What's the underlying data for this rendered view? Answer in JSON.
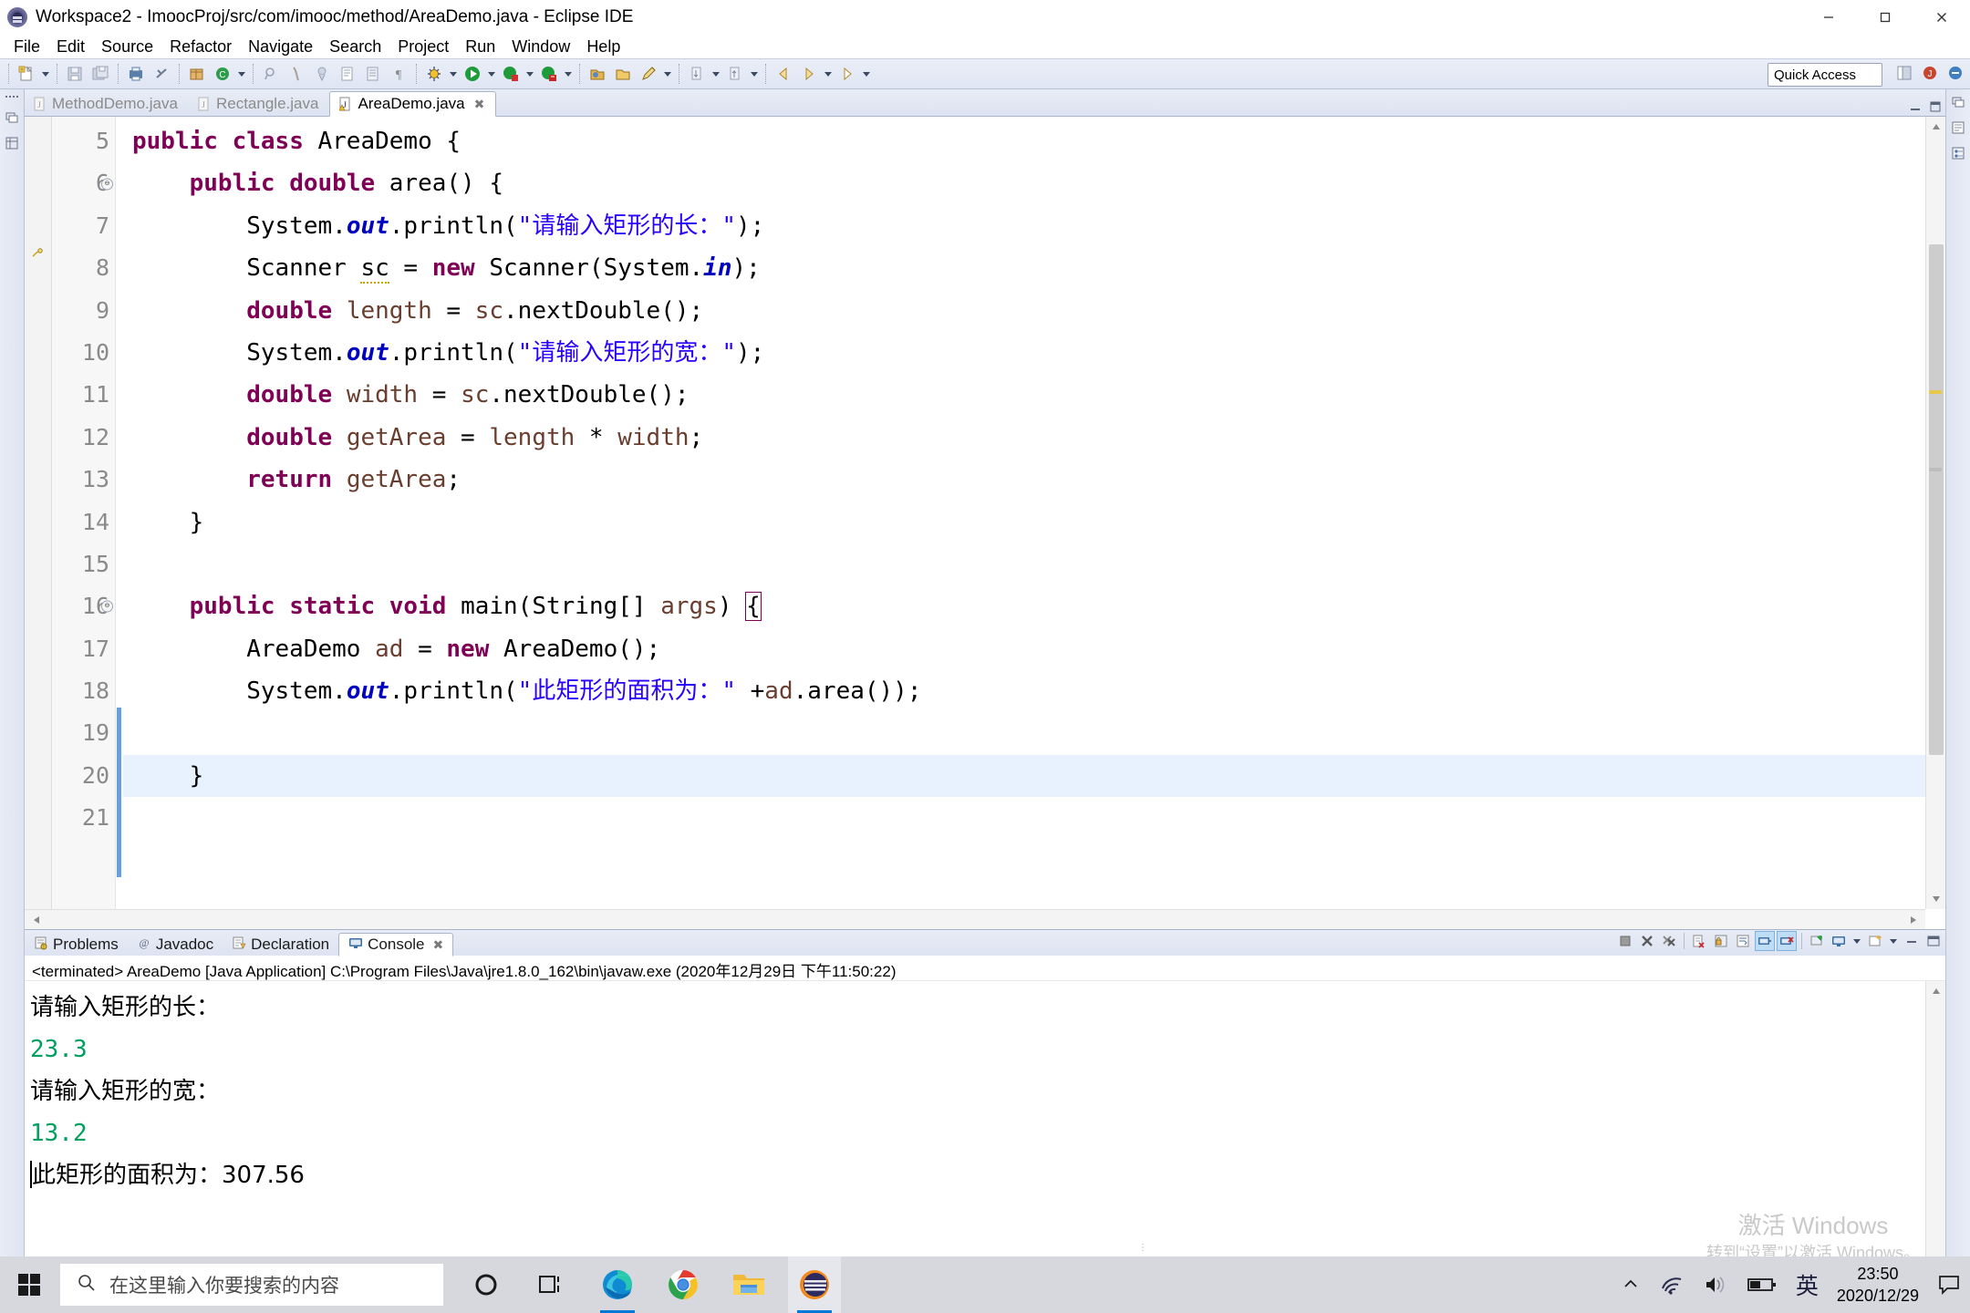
{
  "window": {
    "title": "Workspace2 - ImoocProj/src/com/imooc/method/AreaDemo.java - Eclipse IDE",
    "app_icon": "eclipse-icon",
    "minimize": "minimize-icon",
    "maximize": "maximize-icon",
    "close": "close-icon"
  },
  "menu": {
    "items": [
      "File",
      "Edit",
      "Source",
      "Refactor",
      "Navigate",
      "Search",
      "Project",
      "Run",
      "Window",
      "Help"
    ]
  },
  "toolbar": {
    "quick_access_label": "Quick Access",
    "groups": [
      [
        "new-wizard-icon",
        "dropdown-arrow"
      ],
      [
        "save-icon",
        "save-all-icon"
      ],
      [
        "print-icon",
        "link-broken-icon"
      ],
      [
        "new-java-package-icon",
        "new-java-class-icon",
        "dropdown-arrow"
      ],
      [
        "search-field-icon",
        "open-type-icon",
        "open-task-icon",
        "toggle-mark-occurrences-icon",
        "show-whitespace-icon",
        "pilcrow-icon"
      ],
      [
        "debug-icon",
        "dropdown-arrow",
        "run-icon",
        "dropdown-arrow",
        "coverage-icon",
        "dropdown-arrow",
        "external-tools-icon",
        "dropdown-arrow"
      ],
      [
        "open-perspective-icon",
        "open-folder-icon",
        "pencil-icon",
        "dropdown-arrow"
      ],
      [
        "next-annotation-icon",
        "dropdown-arrow",
        "previous-annotation-icon",
        "dropdown-arrow"
      ],
      [
        "back-icon",
        "forward-icon",
        "dropdown-arrow",
        "forward-nav-icon",
        "dropdown-arrow"
      ]
    ]
  },
  "editor": {
    "tabs": [
      {
        "label": "MethodDemo.java",
        "active": false,
        "icon": "java-file-icon"
      },
      {
        "label": "Rectangle.java",
        "active": false,
        "icon": "java-file-icon"
      },
      {
        "label": "AreaDemo.java",
        "active": true,
        "icon": "java-file-warning-icon",
        "close": "close-tab-icon"
      }
    ],
    "first_line_number": 5,
    "lines": [
      {
        "n": 5,
        "folding": false,
        "highlight": false,
        "annot": "",
        "tokens": [
          {
            "t": "public ",
            "c": "kw"
          },
          {
            "t": "class ",
            "c": "kw"
          },
          {
            "t": "AreaDemo {",
            "c": "plain"
          }
        ]
      },
      {
        "n": 6,
        "folding": true,
        "highlight": false,
        "annot": "",
        "tokens": [
          {
            "t": "    ",
            "c": "plain"
          },
          {
            "t": "public ",
            "c": "kw"
          },
          {
            "t": "double ",
            "c": "kw"
          },
          {
            "t": "area() {",
            "c": "plain"
          }
        ]
      },
      {
        "n": 7,
        "folding": false,
        "highlight": false,
        "annot": "",
        "tokens": [
          {
            "t": "        System.",
            "c": "plain"
          },
          {
            "t": "out",
            "c": "fld"
          },
          {
            "t": ".println(",
            "c": "plain"
          },
          {
            "t": "\"请输入矩形的长：\"",
            "c": "str"
          },
          {
            "t": ");",
            "c": "plain"
          }
        ]
      },
      {
        "n": 8,
        "folding": false,
        "highlight": false,
        "annot": "warning-icon",
        "tokens": [
          {
            "t": "        Scanner ",
            "c": "plain"
          },
          {
            "t": "sc",
            "c": "warnu"
          },
          {
            "t": " = ",
            "c": "plain"
          },
          {
            "t": "new ",
            "c": "kw"
          },
          {
            "t": "Scanner(System.",
            "c": "plain"
          },
          {
            "t": "in",
            "c": "fld"
          },
          {
            "t": ");",
            "c": "plain"
          }
        ]
      },
      {
        "n": 9,
        "folding": false,
        "highlight": false,
        "annot": "",
        "tokens": [
          {
            "t": "        ",
            "c": "plain"
          },
          {
            "t": "double ",
            "c": "kw"
          },
          {
            "t": "length",
            "c": "loc"
          },
          {
            "t": " = ",
            "c": "plain"
          },
          {
            "t": "sc",
            "c": "loc"
          },
          {
            "t": ".nextDouble();",
            "c": "plain"
          }
        ]
      },
      {
        "n": 10,
        "folding": false,
        "highlight": false,
        "annot": "",
        "tokens": [
          {
            "t": "        System.",
            "c": "plain"
          },
          {
            "t": "out",
            "c": "fld"
          },
          {
            "t": ".println(",
            "c": "plain"
          },
          {
            "t": "\"请输入矩形的宽：\"",
            "c": "str"
          },
          {
            "t": ");",
            "c": "plain"
          }
        ]
      },
      {
        "n": 11,
        "folding": false,
        "highlight": false,
        "annot": "",
        "tokens": [
          {
            "t": "        ",
            "c": "plain"
          },
          {
            "t": "double ",
            "c": "kw"
          },
          {
            "t": "width",
            "c": "loc"
          },
          {
            "t": " = ",
            "c": "plain"
          },
          {
            "t": "sc",
            "c": "loc"
          },
          {
            "t": ".nextDouble();",
            "c": "plain"
          }
        ]
      },
      {
        "n": 12,
        "folding": false,
        "highlight": false,
        "annot": "",
        "tokens": [
          {
            "t": "        ",
            "c": "plain"
          },
          {
            "t": "double ",
            "c": "kw"
          },
          {
            "t": "getArea",
            "c": "loc"
          },
          {
            "t": " = ",
            "c": "plain"
          },
          {
            "t": "length",
            "c": "loc"
          },
          {
            "t": " * ",
            "c": "plain"
          },
          {
            "t": "width",
            "c": "loc"
          },
          {
            "t": ";",
            "c": "plain"
          }
        ]
      },
      {
        "n": 13,
        "folding": false,
        "highlight": false,
        "annot": "",
        "tokens": [
          {
            "t": "        ",
            "c": "plain"
          },
          {
            "t": "return ",
            "c": "kw"
          },
          {
            "t": "getArea",
            "c": "loc"
          },
          {
            "t": ";",
            "c": "plain"
          }
        ]
      },
      {
        "n": 14,
        "folding": false,
        "highlight": false,
        "annot": "",
        "tokens": [
          {
            "t": "    }",
            "c": "plain"
          }
        ]
      },
      {
        "n": 15,
        "folding": false,
        "highlight": false,
        "annot": "",
        "tokens": [
          {
            "t": "",
            "c": "plain"
          }
        ]
      },
      {
        "n": 16,
        "folding": true,
        "highlight": false,
        "annot": "",
        "tokens": [
          {
            "t": "    ",
            "c": "plain"
          },
          {
            "t": "public ",
            "c": "kw"
          },
          {
            "t": "static ",
            "c": "kw"
          },
          {
            "t": "void ",
            "c": "kw"
          },
          {
            "t": "main(String[] ",
            "c": "plain"
          },
          {
            "t": "args",
            "c": "loc"
          },
          {
            "t": ") ",
            "c": "plain"
          },
          {
            "t": "{",
            "c": "brk"
          }
        ]
      },
      {
        "n": 17,
        "folding": false,
        "highlight": false,
        "annot": "",
        "tokens": [
          {
            "t": "        AreaDemo ",
            "c": "plain"
          },
          {
            "t": "ad",
            "c": "loc"
          },
          {
            "t": " = ",
            "c": "plain"
          },
          {
            "t": "new ",
            "c": "kw"
          },
          {
            "t": "AreaDemo();",
            "c": "plain"
          }
        ]
      },
      {
        "n": 18,
        "folding": false,
        "highlight": false,
        "annot": "",
        "tokens": [
          {
            "t": "        System.",
            "c": "plain"
          },
          {
            "t": "out",
            "c": "fld"
          },
          {
            "t": ".println(",
            "c": "plain"
          },
          {
            "t": "\"此矩形的面积为：\"",
            "c": "str"
          },
          {
            "t": " +",
            "c": "plain"
          },
          {
            "t": "ad",
            "c": "loc"
          },
          {
            "t": ".area());",
            "c": "plain"
          }
        ]
      },
      {
        "n": 19,
        "folding": false,
        "highlight": false,
        "annot": "",
        "tokens": [
          {
            "t": "",
            "c": "plain"
          }
        ]
      },
      {
        "n": 20,
        "folding": false,
        "highlight": true,
        "annot": "",
        "tokens": [
          {
            "t": "    }",
            "c": "plain"
          }
        ]
      },
      {
        "n": 21,
        "folding": false,
        "highlight": false,
        "annot": "",
        "tokens": [
          {
            "t": "",
            "c": "plain"
          }
        ]
      }
    ]
  },
  "bottom_panel": {
    "tabs": [
      {
        "label": "Problems",
        "icon": "problems-icon",
        "active": false
      },
      {
        "label": "Javadoc",
        "icon": "javadoc-at-icon",
        "active": false
      },
      {
        "label": "Declaration",
        "icon": "declaration-icon",
        "active": false
      },
      {
        "label": "Console",
        "icon": "console-monitor-icon",
        "active": true,
        "close": "close-tab-icon"
      }
    ],
    "toolbar_buttons": [
      "terminate-icon",
      "remove-launch-icon",
      "remove-all-terminated-icon",
      "clear-console-icon",
      "lock-scroll-icon",
      "word-wrap-icon",
      "show-console-on-output-icon",
      "show-console-on-error-icon",
      "pin-console-icon",
      "display-selected-console-icon",
      "dropdown-arrow",
      "open-console-icon",
      "dropdown-arrow",
      "minimize-icon",
      "maximize-icon"
    ],
    "process_header": "<terminated> AreaDemo [Java Application] C:\\Program Files\\Java\\jre1.8.0_162\\bin\\javaw.exe (2020年12月29日 下午11:50:22)",
    "output": [
      {
        "text": "请输入矩形的长：",
        "kind": "stdout"
      },
      {
        "text": "23.3",
        "kind": "input"
      },
      {
        "text": "请输入矩形的宽：",
        "kind": "stdout"
      },
      {
        "text": "13.2",
        "kind": "input"
      },
      {
        "text": "此矩形的面积为：307.56",
        "kind": "stdout"
      }
    ]
  },
  "watermark": {
    "line1": "激活 Windows",
    "line2": "转到“设置”以激活 Windows。"
  },
  "taskbar": {
    "start_icon": "windows-start-icon",
    "search_placeholder": "在这里输入你要搜索的内容",
    "search_icon": "search-icon",
    "apps": [
      {
        "name": "cortana-icon",
        "active": false
      },
      {
        "name": "task-view-icon",
        "active": false
      },
      {
        "name": "microsoft-edge-icon",
        "active": false,
        "running": true
      },
      {
        "name": "google-chrome-icon",
        "active": false
      },
      {
        "name": "file-explorer-icon",
        "active": false
      },
      {
        "name": "eclipse-icon",
        "active": true
      }
    ],
    "tray": {
      "chevron": "show-hidden-icons-icon",
      "network": "wifi-icon",
      "volume": "speaker-icon",
      "battery": "battery-icon",
      "ime": "英",
      "time": "23:50",
      "date": "2020/12/29",
      "notifications": "action-center-icon"
    }
  },
  "colors": {
    "keyword": "#7f0055",
    "string": "#2a00ff",
    "field": "#0000c0",
    "local": "#6a3e2f",
    "console_input": "#00a060",
    "accent": "#0078d7"
  }
}
